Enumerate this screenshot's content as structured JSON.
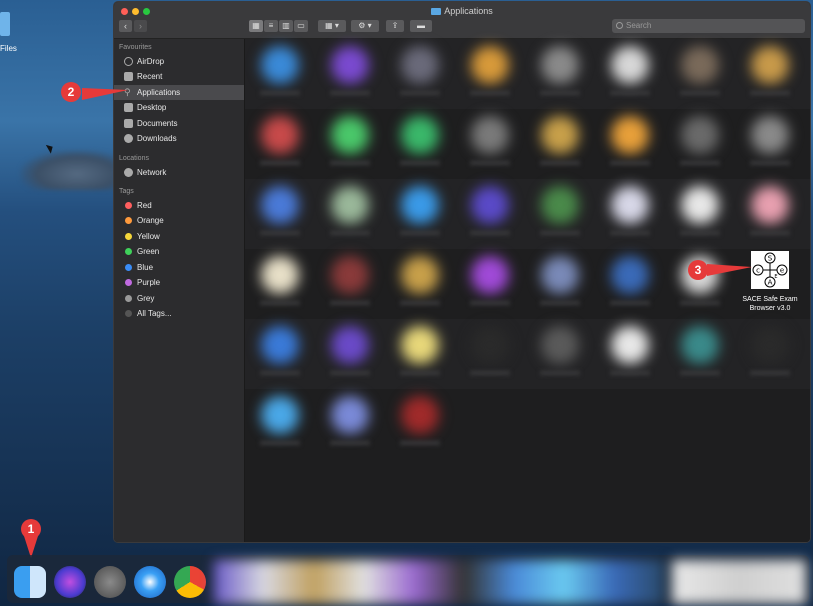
{
  "desktop": {
    "files_label": "Files"
  },
  "window": {
    "title": "Applications",
    "search_placeholder": "Search"
  },
  "sidebar": {
    "favourites_header": "Favourites",
    "favourites": [
      "AirDrop",
      "Recent",
      "Applications",
      "Desktop",
      "Documents",
      "Downloads"
    ],
    "locations_header": "Locations",
    "locations": [
      "Network"
    ],
    "tags_header": "Tags",
    "tags": [
      {
        "label": "Red",
        "color": "#ff5f5f"
      },
      {
        "label": "Orange",
        "color": "#ff9a3c"
      },
      {
        "label": "Yellow",
        "color": "#f5d63a"
      },
      {
        "label": "Green",
        "color": "#3fd15a"
      },
      {
        "label": "Blue",
        "color": "#3a8cf5"
      },
      {
        "label": "Purple",
        "color": "#c06ae0"
      },
      {
        "label": "Grey",
        "color": "#9a9a9a"
      },
      {
        "label": "All Tags...",
        "color": "#555555"
      }
    ]
  },
  "content": {
    "sace_label_line1": "SACE Safe Exam",
    "sace_label_line2": "Browser v3.0",
    "sace_letters": [
      "S",
      "c",
      "e",
      "A",
      "E"
    ]
  },
  "annotations": {
    "badge1": "1",
    "badge2": "2",
    "badge3": "3"
  }
}
